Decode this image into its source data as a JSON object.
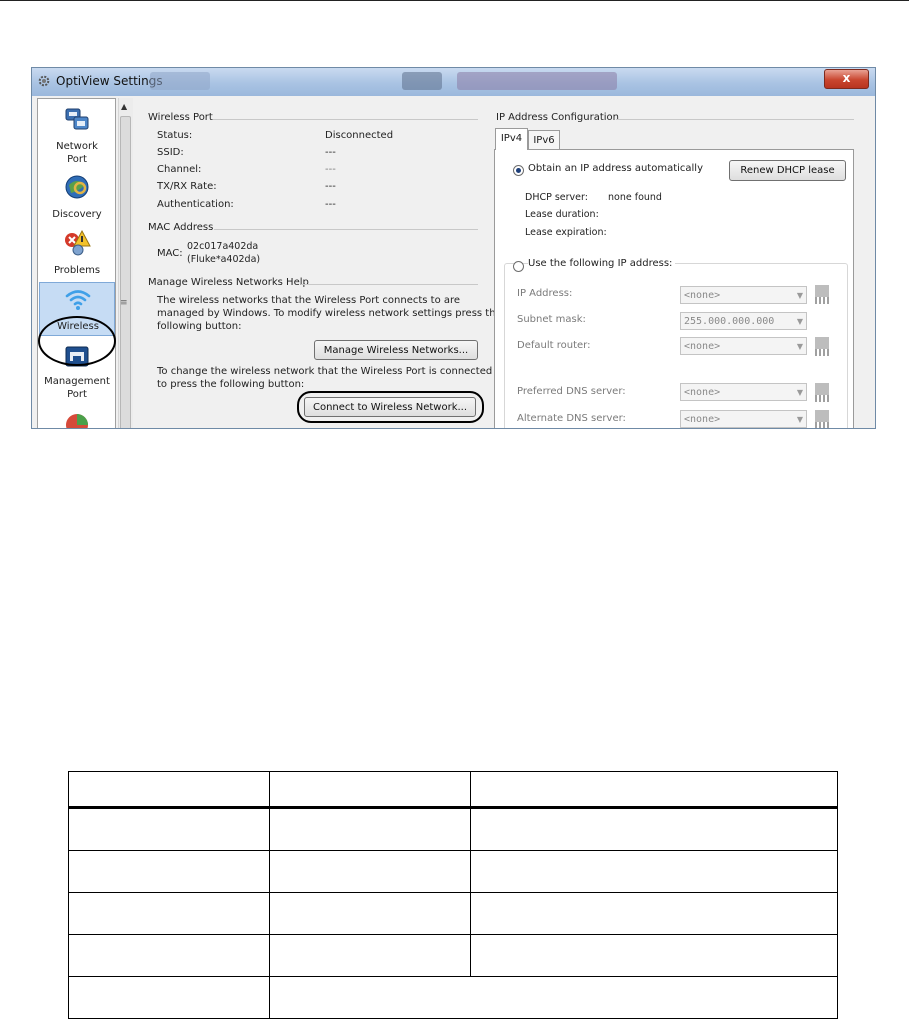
{
  "window": {
    "title": "OptiView Settings",
    "close_label": "x"
  },
  "nav": {
    "items": [
      {
        "label_1": "Network",
        "label_2": "Port",
        "icon": "network-port-icon"
      },
      {
        "label_1": "Discovery",
        "label_2": "",
        "icon": "discovery-icon"
      },
      {
        "label_1": "Problems",
        "label_2": "",
        "icon": "problems-icon"
      },
      {
        "label_1": "Wireless",
        "label_2": "",
        "icon": "wireless-icon",
        "selected": true
      },
      {
        "label_1": "Management",
        "label_2": "Port",
        "icon": "management-port-icon"
      }
    ]
  },
  "wireless_port": {
    "header": "Wireless Port",
    "rows": [
      {
        "label": "Status:",
        "value": "Disconnected"
      },
      {
        "label": "SSID:",
        "value": "---"
      },
      {
        "label": "Channel:",
        "value": "---"
      },
      {
        "label": "TX/RX Rate:",
        "value": "---"
      },
      {
        "label": "Authentication:",
        "value": "---"
      }
    ]
  },
  "mac": {
    "header": "MAC Address",
    "label": "MAC:",
    "value_1": "02c017a402da",
    "value_2": "(Fluke*a402da)"
  },
  "manage": {
    "header": "Manage Wireless Networks Help",
    "text_1": "The wireless networks that the Wireless Port connects to are",
    "text_2": "managed by Windows. To modify wireless network settings press the",
    "text_3": "following button:",
    "manage_button": "Manage Wireless Networks...",
    "text_4": "To change the wireless network that the Wireless Port is connected",
    "text_5": "to press the following button:",
    "connect_button": "Connect to Wireless Network..."
  },
  "ip": {
    "header": "IP Address Configuration",
    "tabs": [
      "IPv4",
      "IPv6"
    ],
    "auto_label": "Obtain an IP address automatically",
    "renew_button": "Renew DHCP lease",
    "dhcp_server_label": "DHCP server:",
    "dhcp_server_value": "none found",
    "lease_duration_label": "Lease duration:",
    "lease_expiration_label": "Lease expiration:",
    "manual_label": "Use the following IP address:",
    "fields": [
      {
        "label": "IP Address:",
        "value": "<none>"
      },
      {
        "label": "Subnet mask:",
        "value": "255.000.000.000"
      },
      {
        "label": "Default router:",
        "value": "<none>"
      },
      {
        "label": "Preferred DNS server:",
        "value": "<none>"
      },
      {
        "label": "Alternate DNS server:",
        "value": "<none>"
      }
    ]
  },
  "colors": {
    "titlebar": "#a9c3e3",
    "selection": "#c6dcf4",
    "close_button": "#c9462f"
  }
}
